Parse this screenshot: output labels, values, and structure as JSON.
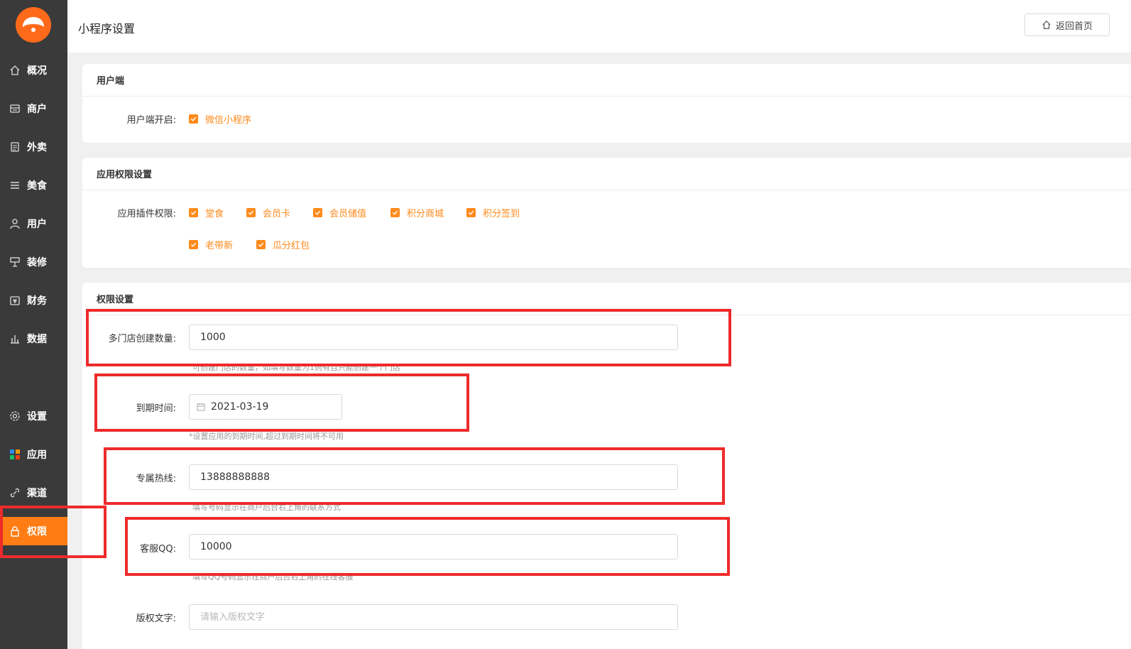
{
  "sidebar": {
    "items": [
      {
        "label": "概况",
        "icon": "home-icon"
      },
      {
        "label": "商户",
        "icon": "store-icon"
      },
      {
        "label": "外卖",
        "icon": "document-icon"
      },
      {
        "label": "美食",
        "icon": "menu-icon"
      },
      {
        "label": "用户",
        "icon": "user-icon"
      },
      {
        "label": "装修",
        "icon": "brush-icon"
      },
      {
        "label": "财务",
        "icon": "finance-icon"
      },
      {
        "label": "数据",
        "icon": "chart-icon"
      },
      {
        "label": "设置",
        "icon": "gear-icon"
      },
      {
        "label": "应用",
        "icon": "apps-icon"
      },
      {
        "label": "渠道",
        "icon": "link-icon"
      },
      {
        "label": "权限",
        "icon": "lock-icon"
      }
    ],
    "active": "权限"
  },
  "header": {
    "title": "小程序设置",
    "home_button": "返回首页"
  },
  "user_section": {
    "title": "用户端",
    "open_label": "用户端开启:",
    "options": [
      "微信小程序"
    ]
  },
  "permission_section": {
    "title": "应用权限设置",
    "plugin_label": "应用插件权限:",
    "plugins": [
      "堂食",
      "会员卡",
      "会员储值",
      "积分商城",
      "积分签到",
      "老带新",
      "瓜分红包"
    ]
  },
  "auth_section": {
    "title": "权限设置",
    "store_count": {
      "label": "多门店创建数量:",
      "value": "1000",
      "hint": "可创建门店的数量，如填写数量为1则有且只能创建一个门店"
    },
    "expire": {
      "label": "到期时间:",
      "value": "2021-03-19",
      "hint": "*设置应用的到期时间,超过到期时间将不可用"
    },
    "hotline": {
      "label": "专属热线:",
      "value": "13888888888",
      "hint": "填写号码显示在商户后台右上角的联系方式"
    },
    "qq": {
      "label": "客服QQ:",
      "value": "10000",
      "hint": "填写QQ号码显示在商户后台右上角的在线客服"
    },
    "copyright": {
      "label": "版权文字:",
      "placeholder": "请输入版权文字"
    }
  },
  "colors": {
    "accent": "#ff7d14",
    "sidebar_bg": "#3a3a3a",
    "highlight": "#ee2b2b"
  }
}
